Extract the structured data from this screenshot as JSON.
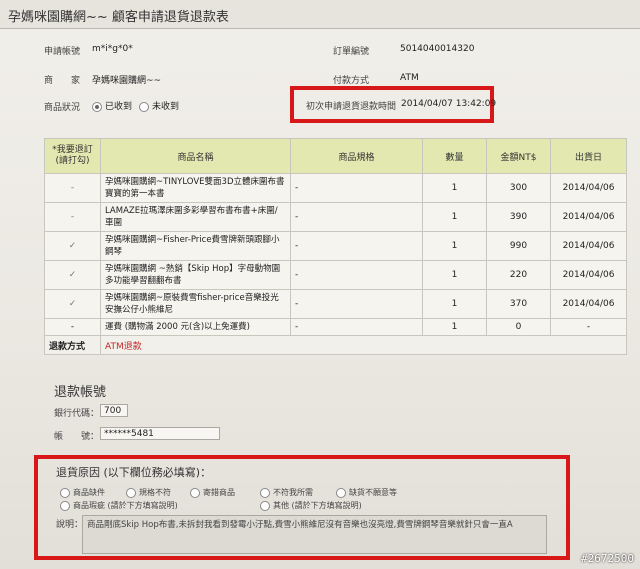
{
  "header": {
    "title": "孕媽咪園購網~~ 顧客申請退貨退款表"
  },
  "order": {
    "account_label": "申請帳號",
    "account_value": "m*i*g*0*",
    "order_no_label": "訂單編號",
    "order_no_value": "5014040014320",
    "merchant_label": "商　　家",
    "merchant_value": "孕媽咪園購網~~",
    "payment_label": "付款方式",
    "payment_value": "ATM",
    "status_label": "商品狀況",
    "status_opt1": "已收到",
    "status_opt2": "未收到",
    "apply_time_label": "初次申請退貨退款時間",
    "apply_time_value": "2014/04/07 13:42:09"
  },
  "table": {
    "headers": [
      "*我要退訂\n(請打勾)",
      "商品名稱",
      "商品規格",
      "數量",
      "金額NT$",
      "出貨日"
    ],
    "rows": [
      {
        "check": "-",
        "name": "孕媽咪園購網~TINYLOVE雙面3D立體床圍布書寶寶的第一本書",
        "spec": "-",
        "qty": "1",
        "price": "300",
        "date": "2014/04/06"
      },
      {
        "check": "-",
        "name": "LAMAZE拉瑪澤床圍多彩學習布書布書+床圍/車圍",
        "spec": "-",
        "qty": "1",
        "price": "390",
        "date": "2014/04/06"
      },
      {
        "check": "✓",
        "name": "孕媽咪園購網~Fisher-Price費雪牌新頭跟腳小鋼琴",
        "spec": "-",
        "qty": "1",
        "price": "990",
        "date": "2014/04/06"
      },
      {
        "check": "✓",
        "name": "孕媽咪園購網 ~熱銷【Skip Hop】字母動物園多功能學習翻翻布書",
        "spec": "-",
        "qty": "1",
        "price": "220",
        "date": "2014/04/06"
      },
      {
        "check": "✓",
        "name": "孕媽咪園購網~原裝費雪fisher-price音樂投光安撫公仔小熊維尼",
        "spec": "-",
        "qty": "1",
        "price": "370",
        "date": "2014/04/06"
      }
    ],
    "shipping": {
      "check": "-",
      "name": "運費 (購物滿 2000 元(含)以上免運費)",
      "spec": "-",
      "qty": "1",
      "price": "0",
      "date": "-"
    },
    "refund_method_label": "退款方式",
    "refund_method_value": "ATM退款"
  },
  "refund_account": {
    "heading": "退款帳號",
    "bank_label": "銀行代碼：",
    "bank_value": "700",
    "acct_label": "帳　　號：",
    "acct_value": "******5481"
  },
  "reason": {
    "heading": "退貨原因 (以下欄位務必填寫)：",
    "opts": [
      "商品缺件",
      "規格不符",
      "寄錯商品",
      "不符我所需",
      "缺貨不願意等",
      "商品瑕疵 (請於下方填寫說明)",
      "其他 (請於下方填寫說明)"
    ],
    "desc_label": "說明：",
    "desc_value": "商品剛底Skip Hop布書,未拆封我看到發霉小汙點,費雪小熊維尼沒有音樂也沒亮燈,費雪牌鋼琴音樂就針只會一直A"
  },
  "watermark": "#2672500",
  "colors": {
    "highlight_red": "#d81818",
    "table_header_bg": "#e3e8b0",
    "refund_red": "#c0282a"
  }
}
